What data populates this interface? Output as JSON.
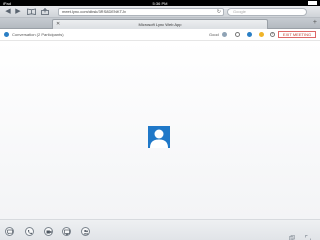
{
  "status_bar": {
    "carrier": "iPad",
    "time": "5:36 PM"
  },
  "browser": {
    "url": "meet.lync.com/dbsk/3RS8DENKTJv",
    "search_placeholder": "Google",
    "tab_title": "Microsoft Lync Web App"
  },
  "meeting_header": {
    "conversation_title": "Conversation (2 Participants)",
    "status_label": "Good",
    "exit_label": "EXIT MEETING"
  },
  "colors": {
    "lync_blue": "#1f78c8",
    "exit_red": "#c0392b"
  },
  "controls": [
    "im-icon",
    "phone-icon",
    "video-icon",
    "present-icon",
    "participants-icon"
  ]
}
